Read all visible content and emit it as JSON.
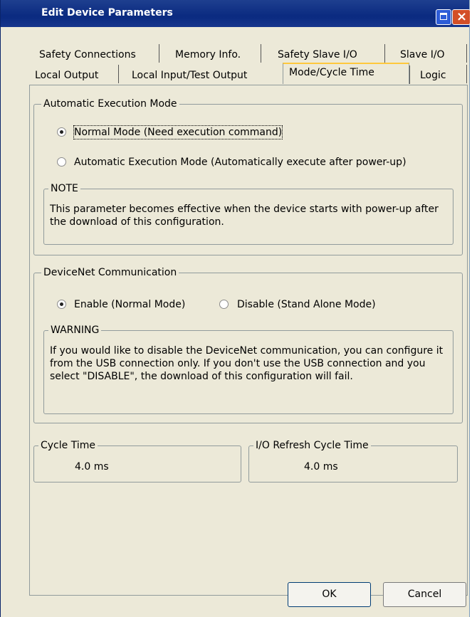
{
  "window": {
    "title": "Edit Device Parameters"
  },
  "tabs": {
    "row1": [
      "Safety Connections",
      "Memory Info.",
      "Safety Slave I/O",
      "Slave I/O"
    ],
    "row2": [
      "Local Output",
      "Local Input/Test Output",
      "Mode/Cycle Time",
      "Logic"
    ],
    "active": "Mode/Cycle Time"
  },
  "auto_exec": {
    "title": "Automatic Execution Mode",
    "option_normal": "Normal Mode (Need execution command)",
    "option_auto": "Automatic Execution Mode (Automatically execute after power-up)",
    "selected": "normal",
    "note_title": "NOTE",
    "note_text": "This parameter becomes effective when the device starts with power-up after the download of this configuration."
  },
  "devicenet": {
    "title": "DeviceNet Communication",
    "option_enable": "Enable (Normal Mode)",
    "option_disable": "Disable (Stand Alone Mode)",
    "selected": "enable",
    "warning_title": "WARNING",
    "warning_text": "If you would like to disable the DeviceNet communication, you can configure it from the USB connection only. If you don't use the USB connection and you select \"DISABLE\", the download of this configuration will fail."
  },
  "cycle_time": {
    "title": "Cycle Time",
    "value": "4.0 ms"
  },
  "io_refresh": {
    "title": "I/O Refresh Cycle Time",
    "value": "4.0 ms"
  },
  "buttons": {
    "ok": "OK",
    "cancel": "Cancel"
  },
  "colors": {
    "titlebar": "#0a2a80",
    "dialog_bg": "#ece9d8",
    "close": "#d34f27",
    "active_tab_accent": "#ffc83d"
  }
}
